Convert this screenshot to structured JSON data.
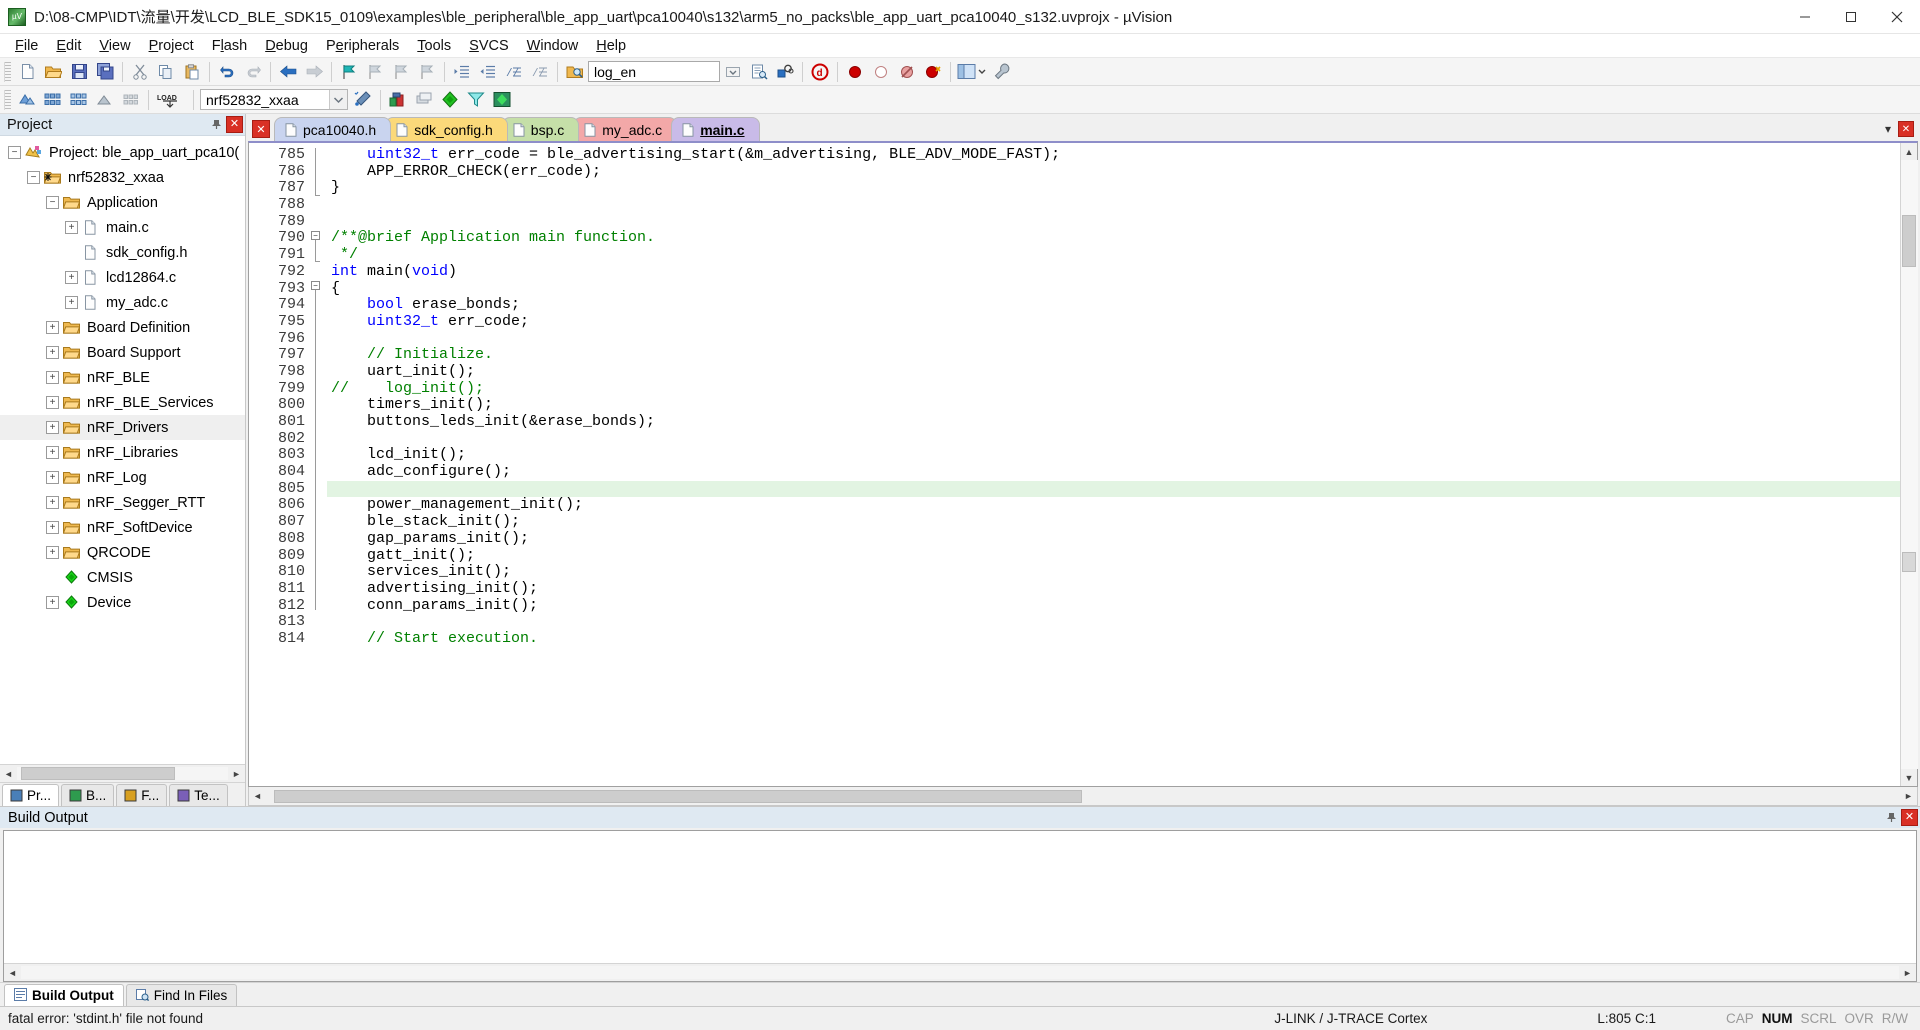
{
  "window": {
    "title": "D:\\08-CMP\\IDT\\流量\\开发\\LCD_BLE_SDK15_0109\\examples\\ble_peripheral\\ble_app_uart\\pca10040\\s132\\arm5_no_packs\\ble_app_uart_pca10040_s132.uvprojx - µVision",
    "app_icon": "uvision-icon",
    "minimize_label": "—",
    "maximize_label": "▢",
    "close_label": "✕"
  },
  "menu": {
    "items": [
      {
        "label": "File",
        "accel": "F"
      },
      {
        "label": "Edit",
        "accel": "E"
      },
      {
        "label": "View",
        "accel": "V"
      },
      {
        "label": "Project",
        "accel": "P"
      },
      {
        "label": "Flash",
        "accel": "l"
      },
      {
        "label": "Debug",
        "accel": "D"
      },
      {
        "label": "Peripherals",
        "accel": "e"
      },
      {
        "label": "Tools",
        "accel": "T"
      },
      {
        "label": "SVCS",
        "accel": "S"
      },
      {
        "label": "Window",
        "accel": "W"
      },
      {
        "label": "Help",
        "accel": "H"
      }
    ]
  },
  "toolbar_main": {
    "buttons": [
      {
        "name": "new-file-icon",
        "glyph": "new"
      },
      {
        "name": "open-file-icon",
        "glyph": "open"
      },
      {
        "name": "save-icon",
        "glyph": "save"
      },
      {
        "name": "save-all-icon",
        "glyph": "saveall"
      },
      {
        "name": "cut-icon",
        "glyph": "cut"
      },
      {
        "name": "copy-icon",
        "glyph": "copy"
      },
      {
        "name": "paste-icon",
        "glyph": "paste"
      },
      {
        "name": "undo-icon",
        "glyph": "undo"
      },
      {
        "name": "redo-icon",
        "glyph": "redo"
      },
      {
        "name": "navigate-back-icon",
        "glyph": "back"
      },
      {
        "name": "navigate-forward-icon",
        "glyph": "forward"
      },
      {
        "name": "bookmark-toggle-icon",
        "glyph": "bkmk"
      },
      {
        "name": "bookmark-prev-icon",
        "glyph": "bkmkprev"
      },
      {
        "name": "bookmark-next-icon",
        "glyph": "bkmknext"
      },
      {
        "name": "bookmark-clear-icon",
        "glyph": "bkmkclr"
      },
      {
        "name": "indent-icon",
        "glyph": "indent"
      },
      {
        "name": "outdent-icon",
        "glyph": "outdent"
      },
      {
        "name": "comment-icon",
        "glyph": "comment"
      },
      {
        "name": "uncomment-icon",
        "glyph": "uncomment"
      },
      {
        "name": "find-in-files-icon",
        "glyph": "findfiles"
      }
    ],
    "search_value": "log_en",
    "search_placeholder": "",
    "right_buttons": [
      {
        "name": "incremental-find-icon",
        "glyph": "incfind"
      },
      {
        "name": "find-replace-icon",
        "glyph": "findrep"
      },
      {
        "name": "find-icon",
        "glyph": "find"
      },
      {
        "name": "debug-session-icon",
        "glyph": "debug"
      },
      {
        "name": "insert-breakpoint-icon",
        "glyph": "bp"
      },
      {
        "name": "disable-breakpoint-icon",
        "glyph": "bpdis"
      },
      {
        "name": "disable-all-breakpoints-icon",
        "glyph": "bpdisall"
      },
      {
        "name": "kill-all-breakpoints-icon",
        "glyph": "bpkill"
      },
      {
        "name": "window-layout-icon",
        "glyph": "layout"
      },
      {
        "name": "configuration-wizard-icon",
        "glyph": "wrench"
      }
    ]
  },
  "toolbar_build": {
    "buttons": [
      {
        "name": "translate-file-icon",
        "glyph": "translate"
      },
      {
        "name": "build-target-icon",
        "glyph": "build"
      },
      {
        "name": "rebuild-all-icon",
        "glyph": "rebuild"
      },
      {
        "name": "batch-build-icon",
        "glyph": "batch"
      },
      {
        "name": "stop-build-icon",
        "glyph": "stopbuild"
      },
      {
        "name": "download-icon",
        "glyph": "LOAD"
      }
    ],
    "target_value": "nrf52832_xxaa",
    "right_buttons": [
      {
        "name": "target-options-icon",
        "glyph": "wand"
      },
      {
        "name": "manage-project-items-icon",
        "glyph": "manage"
      },
      {
        "name": "manage-multi-project-icon",
        "glyph": "multiproj"
      },
      {
        "name": "pack-installer-icon",
        "glyph": "packinst"
      },
      {
        "name": "manage-run-time-env-icon",
        "glyph": "rte"
      },
      {
        "name": "select-software-packs-icon",
        "glyph": "packs"
      }
    ]
  },
  "project_pane": {
    "title": "Project",
    "pin_label": "⊥",
    "close_label": "✕",
    "tree": [
      {
        "label": "Project: ble_app_uart_pca10(",
        "depth": 0,
        "icon": "project-icon",
        "expander": "minus"
      },
      {
        "label": "nrf52832_xxaa",
        "depth": 1,
        "icon": "target-icon",
        "expander": "minus"
      },
      {
        "label": "Application",
        "depth": 2,
        "icon": "folder-icon",
        "expander": "minus"
      },
      {
        "label": "main.c",
        "depth": 3,
        "icon": "c-file-icon",
        "expander": "plus"
      },
      {
        "label": "sdk_config.h",
        "depth": 3,
        "icon": "h-file-icon",
        "expander": "none"
      },
      {
        "label": "lcd12864.c",
        "depth": 3,
        "icon": "c-file-icon",
        "expander": "plus"
      },
      {
        "label": "my_adc.c",
        "depth": 3,
        "icon": "c-file-icon",
        "expander": "plus"
      },
      {
        "label": "Board Definition",
        "depth": 2,
        "icon": "folder-icon",
        "expander": "plus"
      },
      {
        "label": "Board Support",
        "depth": 2,
        "icon": "folder-icon",
        "expander": "plus"
      },
      {
        "label": "nRF_BLE",
        "depth": 2,
        "icon": "folder-icon",
        "expander": "plus"
      },
      {
        "label": "nRF_BLE_Services",
        "depth": 2,
        "icon": "folder-icon",
        "expander": "plus"
      },
      {
        "label": "nRF_Drivers",
        "depth": 2,
        "icon": "folder-icon",
        "expander": "plus",
        "selected": true
      },
      {
        "label": "nRF_Libraries",
        "depth": 2,
        "icon": "folder-icon",
        "expander": "plus"
      },
      {
        "label": "nRF_Log",
        "depth": 2,
        "icon": "folder-icon",
        "expander": "plus"
      },
      {
        "label": "nRF_Segger_RTT",
        "depth": 2,
        "icon": "folder-icon",
        "expander": "plus"
      },
      {
        "label": "nRF_SoftDevice",
        "depth": 2,
        "icon": "folder-icon",
        "expander": "plus"
      },
      {
        "label": "QRCODE",
        "depth": 2,
        "icon": "folder-icon",
        "expander": "plus"
      },
      {
        "label": "CMSIS",
        "depth": 2,
        "icon": "cmsis-icon",
        "expander": "none"
      },
      {
        "label": "Device",
        "depth": 2,
        "icon": "cmsis-icon",
        "expander": "plus"
      }
    ],
    "tabs": [
      {
        "label": "Pr...",
        "icon": "project-tab-icon",
        "active": true
      },
      {
        "label": "B...",
        "icon": "books-tab-icon",
        "active": false
      },
      {
        "label": "F...",
        "icon": "functions-tab-icon",
        "active": false
      },
      {
        "label": "Te...",
        "icon": "templates-tab-icon",
        "active": false
      }
    ]
  },
  "editor": {
    "close_tab_label": "✕",
    "tabs": [
      {
        "label": "pca10040.h",
        "color": "#c9d4ef",
        "icon": "h-file-icon",
        "active": false
      },
      {
        "label": "sdk_config.h",
        "color": "#fbd97a",
        "icon": "h-file-icon",
        "active": false
      },
      {
        "label": "bsp.c",
        "color": "#c5dfa8",
        "icon": "c-file-icon",
        "active": false
      },
      {
        "label": "my_adc.c",
        "color": "#f3a8a8",
        "icon": "c-file-icon",
        "active": false
      },
      {
        "label": "main.c",
        "color": "#c9bbe8",
        "icon": "c-file-icon",
        "active": true
      }
    ],
    "tab_controls": [
      {
        "name": "tab-list-dropdown",
        "glyph": "▾"
      },
      {
        "name": "close-document-button",
        "glyph": "✕"
      }
    ],
    "first_line_number": 785,
    "highlight_line": 805,
    "lines": [
      {
        "n": 785,
        "code": "    uint32_t err_code = ble_advertising_start(&m_advertising, BLE_ADV_MODE_FAST);"
      },
      {
        "n": 786,
        "code": "    APP_ERROR_CHECK(err_code);"
      },
      {
        "n": 787,
        "code": "}"
      },
      {
        "n": 788,
        "code": ""
      },
      {
        "n": 789,
        "code": ""
      },
      {
        "n": 790,
        "code": "/**@brief Application main function."
      },
      {
        "n": 791,
        "code": " */"
      },
      {
        "n": 792,
        "code": "int main(void)"
      },
      {
        "n": 793,
        "code": "{"
      },
      {
        "n": 794,
        "code": "    bool erase_bonds;"
      },
      {
        "n": 795,
        "code": "    uint32_t err_code;"
      },
      {
        "n": 796,
        "code": ""
      },
      {
        "n": 797,
        "code": "    // Initialize."
      },
      {
        "n": 798,
        "code": "    uart_init();"
      },
      {
        "n": 799,
        "code": "//    log_init();"
      },
      {
        "n": 800,
        "code": "    timers_init();"
      },
      {
        "n": 801,
        "code": "    buttons_leds_init(&erase_bonds);"
      },
      {
        "n": 802,
        "code": ""
      },
      {
        "n": 803,
        "code": "    lcd_init();"
      },
      {
        "n": 804,
        "code": "    adc_configure();"
      },
      {
        "n": 805,
        "code": ""
      },
      {
        "n": 806,
        "code": "    power_management_init();"
      },
      {
        "n": 807,
        "code": "    ble_stack_init();"
      },
      {
        "n": 808,
        "code": "    gap_params_init();"
      },
      {
        "n": 809,
        "code": "    gatt_init();"
      },
      {
        "n": 810,
        "code": "    services_init();"
      },
      {
        "n": 811,
        "code": "    advertising_init();"
      },
      {
        "n": 812,
        "code": "    conn_params_init();"
      },
      {
        "n": 813,
        "code": ""
      },
      {
        "n": 814,
        "code": "    // Start execution."
      }
    ]
  },
  "build_output": {
    "title": "Build Output",
    "pin_label": "⊥",
    "close_label": "✕",
    "text": "",
    "tabs": [
      {
        "label": "Build Output",
        "icon": "build-output-icon",
        "active": true
      },
      {
        "label": "Find In Files",
        "icon": "find-in-files-icon",
        "active": false
      }
    ]
  },
  "statusbar": {
    "message": "fatal error: 'stdint.h' file not found",
    "debugger": "J-LINK / J-TRACE Cortex",
    "cursor": "L:805 C:1",
    "flags": [
      {
        "label": "CAP",
        "on": false
      },
      {
        "label": "NUM",
        "on": true
      },
      {
        "label": "SCRL",
        "on": false
      },
      {
        "label": "OVR",
        "on": false
      },
      {
        "label": "R/W",
        "on": false
      }
    ]
  },
  "colors": {
    "accent": "#dfe9f2",
    "highlight_line": "#e2f4e2",
    "keyword": "#0000ff",
    "comment": "#008000",
    "close_red": "#d93025"
  }
}
